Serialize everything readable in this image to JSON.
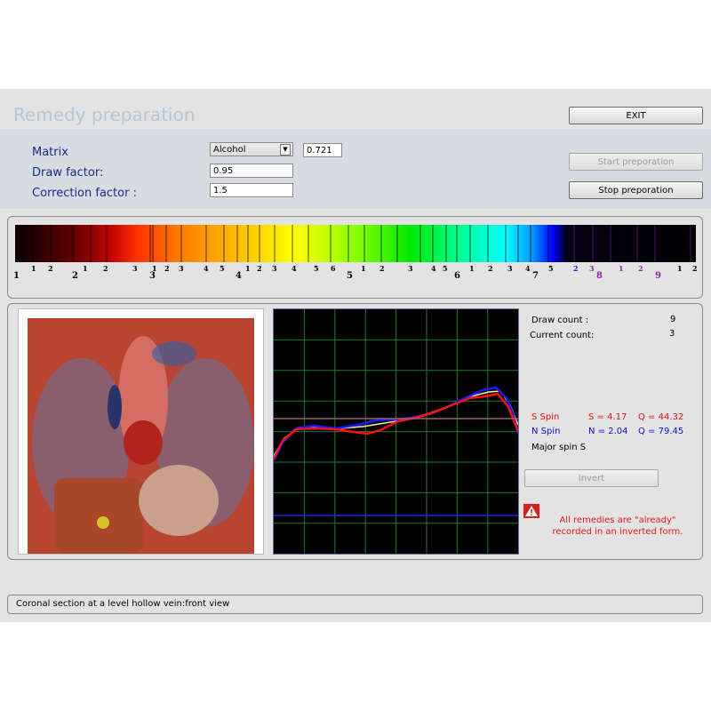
{
  "window": {
    "title": "Remedy preparation"
  },
  "toolbar": {
    "exit_label": "EXIT",
    "start_label": "Start preporation",
    "stop_label": "Stop preporation"
  },
  "settings": {
    "matrix_label": "Matrix",
    "matrix_value": "Alcohol",
    "matrix_number": "0.721",
    "draw_factor_label": "Draw factor:",
    "draw_factor_value": "0.95",
    "correction_label": "Correction factor :",
    "correction_value": "1.5"
  },
  "spectrum": {
    "small_ticks": [
      "1",
      "2",
      "1",
      "2",
      "3",
      "1",
      "2",
      "3",
      "4",
      "5",
      "1",
      "2",
      "3",
      "4",
      "5",
      "6",
      "1",
      "2",
      "3",
      "4",
      "5",
      "1",
      "2",
      "3",
      "4",
      "5",
      "1",
      "2",
      "3",
      "4",
      "1",
      "2",
      "1",
      "2"
    ],
    "big_ticks": [
      "1",
      "2",
      "3",
      "4",
      "5",
      "6",
      "7",
      "8",
      "9"
    ],
    "purple_small_ticks": [
      "3",
      "1",
      "2"
    ],
    "blue_small_ticks": [
      "2"
    ]
  },
  "image_caption": "Coronal section at a level hollow vein:front view",
  "stats": {
    "draw_count_label": "Draw count :",
    "draw_count_value": "9",
    "current_count_label": "Current count:",
    "current_count_value": "3",
    "s_spin_label": "S Spin",
    "s_value": "S = 4.17",
    "s_q": "Q = 44.32",
    "n_spin_label": "N Spin",
    "n_value": "N = 2.04",
    "n_q": "Q = 79.45",
    "major_spin": "Major spin S"
  },
  "invert_label": "Invert",
  "warning_text": "All remedies are \"already\" recorded in an inverted form.",
  "colors": {
    "s_spin": "#e01010",
    "n_spin": "#1010d0",
    "graph_bg": "#000000",
    "grid": "#1f7a2f"
  },
  "icons": {
    "warning": "warning-icon"
  }
}
